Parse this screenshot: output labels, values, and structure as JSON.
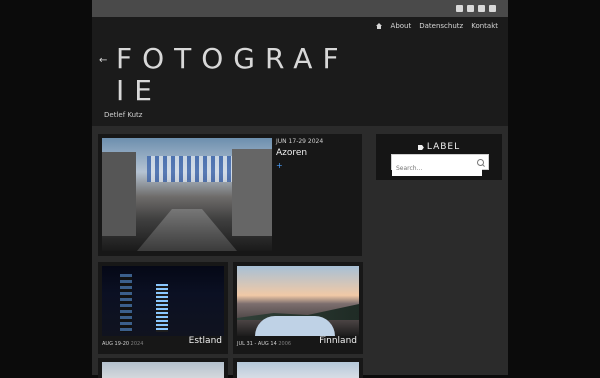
{
  "topbar": {
    "icons": [
      "facebook-icon",
      "twitter-icon",
      "google-plus-icon",
      "instagram-icon"
    ]
  },
  "nav": {
    "items": [
      "About",
      "Datenschutz",
      "Kontakt"
    ]
  },
  "site": {
    "title": "FOTOGRAFIE",
    "subtitle": "Detlef Kutz"
  },
  "posts": [
    {
      "date": "JUN 17-29",
      "year": "2024",
      "title": "Azoren"
    },
    {
      "date": "AUG 19-20",
      "year": "2024",
      "title": "Estland"
    },
    {
      "date": "JUL 31 - AUG 14",
      "year": "2006",
      "title": "Finnland"
    }
  ],
  "widget": {
    "label": "LABEL",
    "search_placeholder": "Search..."
  }
}
